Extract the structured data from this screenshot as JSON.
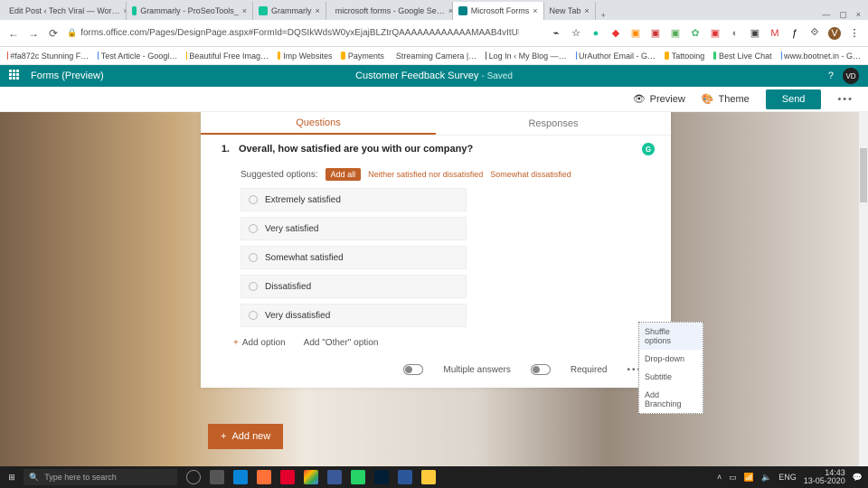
{
  "browser": {
    "tabs": [
      {
        "label": "Edit Post ‹ Tech Viral — Wor…",
        "color": "#2b5ea8"
      },
      {
        "label": "Grammarly - ProSeoTools_",
        "color": "#15c39a"
      },
      {
        "label": "Grammarly",
        "color": "#15c39a"
      },
      {
        "label": "microsoft forms - Google Se…",
        "color": "#4285f4"
      },
      {
        "label": "Microsoft Forms",
        "color": "#038387"
      },
      {
        "label": "New Tab",
        "color": "#ccc"
      }
    ],
    "url": "forms.office.com/Pages/DesignPage.aspx#FormId=DQSIkWdsW0yxEjajBLZtrQAAAAAAAAAAAAMAAB4vItUM05JRTBXN0o5SFBSU0xRWE1SOTFWN…",
    "bookmarks": [
      "#fa872c Stunning F…",
      "Test Article - Googl…",
      "Beautiful Free Imag…",
      "Imp Websites",
      "Payments",
      "Streaming Camera |…",
      "Log In ‹ My Blog —…",
      "UrAuthor Email - G…",
      "Tattooing",
      "Best Live Chat",
      "www.bootnet.in - G…"
    ],
    "addr_avatar": "V"
  },
  "app": {
    "product": "Forms (Preview)",
    "title": "Customer Feedback Survey",
    "saved": " - Saved",
    "preview": "Preview",
    "theme": "Theme",
    "send": "Send",
    "user": "VD"
  },
  "card": {
    "tabQuestions": "Questions",
    "tabResponses": "Responses",
    "qnum": "1.",
    "qtext": "Overall, how satisfied are you with our company?",
    "suggestedLabel": "Suggested options:",
    "addAll": "Add all",
    "suggestedChips": [
      "Neither satisfied nor dissatisfied",
      "Somewhat dissatisfied"
    ],
    "options": [
      "Extremely satisfied",
      "Very satisfied",
      "Somewhat satisfied",
      "Dissatisfied",
      "Very dissatisfied"
    ],
    "addOption": "Add option",
    "addOther": "Add \"Other\" option",
    "multiple": "Multiple answers",
    "required": "Required",
    "addNew": "Add new"
  },
  "ctx": {
    "items": [
      "Shuffle options",
      "Drop-down",
      "Subtitle",
      "Add Branching"
    ]
  },
  "taskbar": {
    "search": "Type here to search",
    "lang": "ENG",
    "time": "14:43",
    "date": "13-05-2020"
  }
}
